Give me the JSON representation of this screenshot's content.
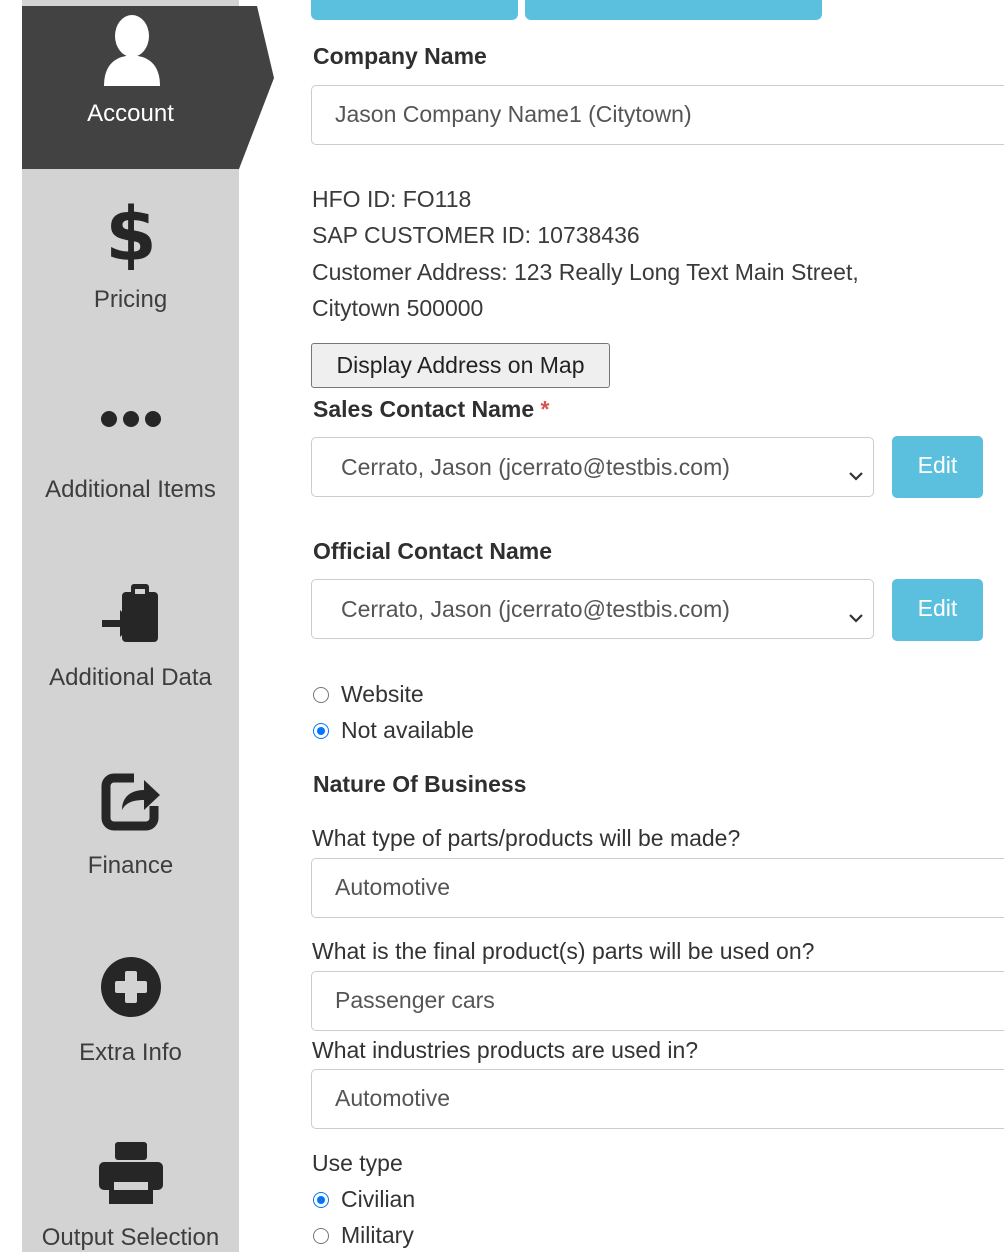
{
  "sidebar": {
    "items": [
      {
        "label": "Account",
        "icon": "user-icon",
        "active": true
      },
      {
        "label": "Pricing",
        "icon": "dollar-icon"
      },
      {
        "label": "Additional Items",
        "icon": "ellipsis-icon"
      },
      {
        "label": "Additional Data",
        "icon": "clipboard-import-icon"
      },
      {
        "label": "Finance",
        "icon": "share-square-icon"
      },
      {
        "label": "Extra Info",
        "icon": "plus-circle-icon"
      },
      {
        "label": "Output Selection",
        "icon": "printer-icon"
      }
    ],
    "active_color": "#424242",
    "background": "#d3d3d3"
  },
  "company": {
    "heading": "Company Name",
    "value": "Jason Company Name1 (Citytown)"
  },
  "info": {
    "hfo_id": "HFO ID: FO118",
    "sap_id": "SAP CUSTOMER ID: 10738436",
    "address_line1": "Customer Address: 123 Really Long Text Main Street,",
    "address_line2": "Citytown 500000"
  },
  "map_button_label": "Display Address on Map",
  "sales_contact": {
    "heading": "Sales Contact Name",
    "required_mark": "*",
    "selected": "Cerrato, Jason (jcerrato@testbis.com)",
    "edit_label": "Edit"
  },
  "official_contact": {
    "heading": "Official Contact Name",
    "selected": "Cerrato, Jason (jcerrato@testbis.com)",
    "edit_label": "Edit"
  },
  "website_options": [
    {
      "label": "Website",
      "checked": false
    },
    {
      "label": "Not available",
      "checked": true
    }
  ],
  "nature_of_business": {
    "heading": "Nature Of Business",
    "q1": "What type of parts/products will be made?",
    "a1": "Automotive",
    "q2": "What is the final product(s) parts will be used on?",
    "a2": "Passenger cars",
    "q3": "What industries products are used in?",
    "a3": "Automotive"
  },
  "use_type": {
    "label": "Use type",
    "options": [
      {
        "label": "Civilian",
        "checked": true
      },
      {
        "label": "Military",
        "checked": false
      }
    ]
  },
  "accent_color": "#5bc0de"
}
